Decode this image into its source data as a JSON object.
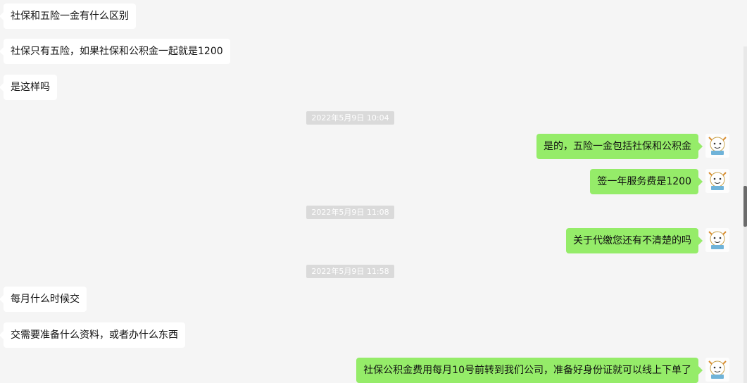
{
  "messages": [
    {
      "text": "社保和五险一金有什么区别"
    },
    {
      "text": "社保只有五险，如果社保和公积金一起就是1200"
    },
    {
      "text": "是这样吗"
    },
    {
      "text": "是的，五险一金包括社保和公积金"
    },
    {
      "text": "签一年服务费是1200"
    },
    {
      "text": "关于代缴您还有不清楚的吗"
    },
    {
      "text": "每月什么时候交"
    },
    {
      "text": "交需要准备什么资料，或者办什么东西"
    },
    {
      "text": "社保公积金费用每月10号前转到我们公司，准备好身份证就可以线上下单了"
    }
  ],
  "timestamps": [
    "2022年5月9日 10:04",
    "2022年5月9日 11:08",
    "2022年5月9日 11:58"
  ],
  "colors": {
    "background": "#f5f5f5",
    "incoming_bubble": "#ffffff",
    "outgoing_bubble": "#95ec69",
    "timestamp_bg": "#dadada"
  },
  "icons": {
    "avatar": "cartoon-avatar-icon"
  }
}
